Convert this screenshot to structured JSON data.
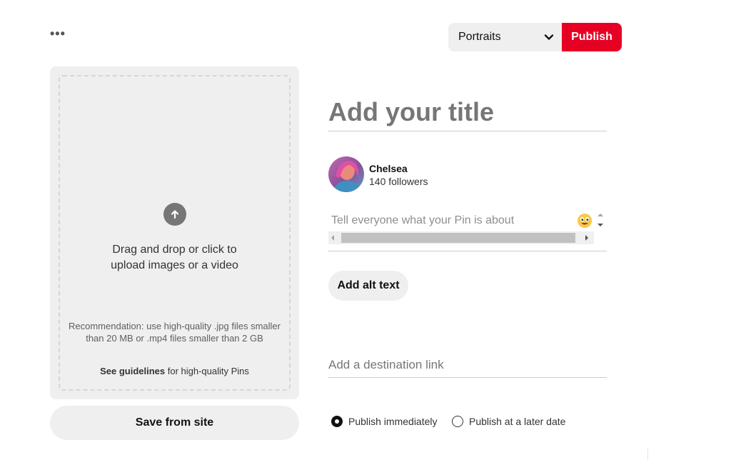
{
  "header": {
    "more_icon_glyph": "•••",
    "board_select": {
      "selected": "Portraits"
    },
    "publish_label": "Publish"
  },
  "colors": {
    "accent": "#e60023",
    "panel": "#efefef"
  },
  "upload": {
    "icon": "arrow-up-icon",
    "drag_text_line1": "Drag and drop or click to",
    "drag_text_line2": "upload images or a video",
    "recommendation": "Recommendation: use high-quality .jpg files smaller than 20 MB or .mp4 files smaller than 2 GB",
    "guidelines_link": "See guidelines",
    "guidelines_suffix": " for high-quality Pins",
    "save_from_site_label": "Save from site"
  },
  "form": {
    "title_placeholder": "Add your title",
    "title_value": "",
    "user": {
      "name": "Chelsea",
      "followers": "140 followers"
    },
    "description_placeholder": "Tell everyone what your Pin is about",
    "description_value": "",
    "alt_text_label": "Add alt text",
    "destination_placeholder": "Add a destination link",
    "destination_value": ""
  },
  "publish_options": {
    "immediately": "Publish immediately",
    "later": "Publish at a later date",
    "selected": "immediately"
  }
}
